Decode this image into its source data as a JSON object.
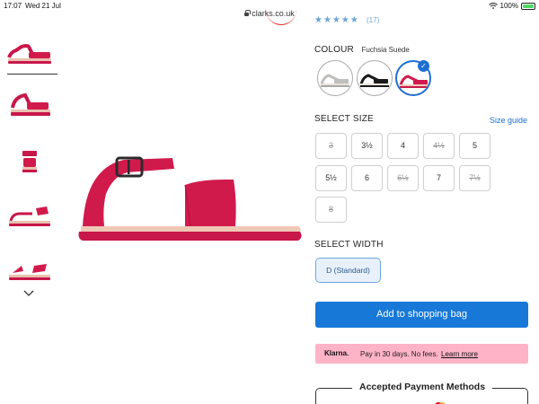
{
  "status_bar": {
    "time": "17:07",
    "date": "Wed 21 Jul",
    "url": "clarks.co.uk",
    "battery": "100%"
  },
  "rating": {
    "stars": "★★★★★",
    "count": "(17)"
  },
  "colour": {
    "label": "COLOUR",
    "value": "Fuchsia Suede",
    "swatches": [
      {
        "name": "grey",
        "color": "#bfc0bd"
      },
      {
        "name": "black",
        "color": "#1a1a1a"
      },
      {
        "name": "fuchsia",
        "color": "#d11a4c"
      }
    ],
    "selected": "fuchsia"
  },
  "size": {
    "label": "SELECT SIZE",
    "guide": "Size guide",
    "options": [
      {
        "label": "3",
        "available": false
      },
      {
        "label": "3½",
        "available": true
      },
      {
        "label": "4",
        "available": true
      },
      {
        "label": "4½",
        "available": false
      },
      {
        "label": "5",
        "available": true
      },
      {
        "label": "5½",
        "available": true
      },
      {
        "label": "6",
        "available": true
      },
      {
        "label": "6½",
        "available": false
      },
      {
        "label": "7",
        "available": true
      },
      {
        "label": "7½",
        "available": false
      },
      {
        "label": "8",
        "available": false
      }
    ]
  },
  "width": {
    "label": "SELECT WIDTH",
    "selected": "D (Standard)"
  },
  "add_to_bag": "Add to shopping bag",
  "klarna": {
    "logo": "Klarna.",
    "message": "Pay in 30 days. No fees.",
    "link": "Learn more"
  },
  "payment": {
    "title": "Accepted Payment Methods"
  },
  "colors": {
    "product": "#d11a4c",
    "accent": "#1778d8",
    "klarna_bg": "#ffb3c7"
  }
}
